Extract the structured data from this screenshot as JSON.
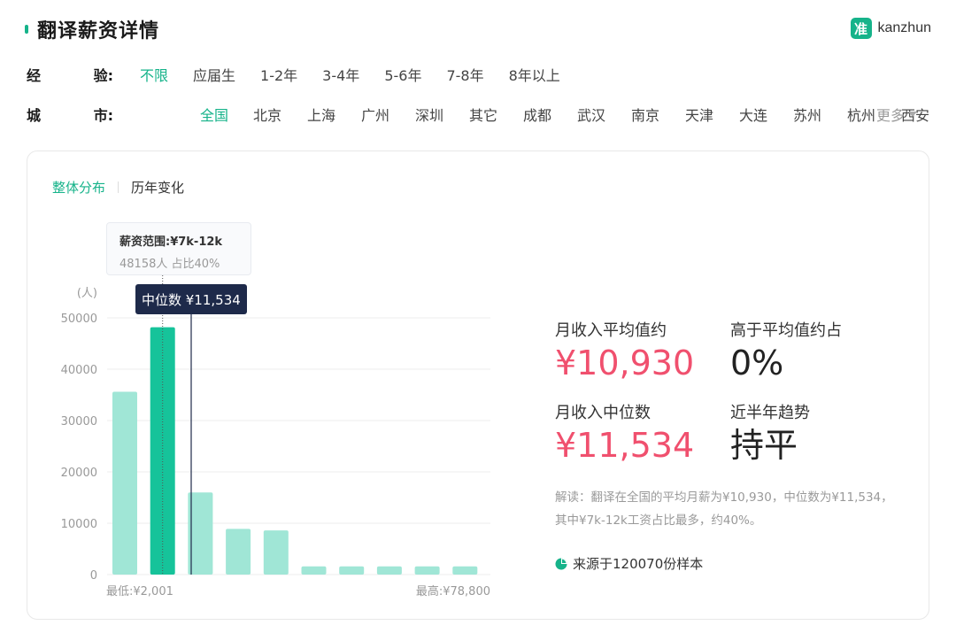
{
  "header": {
    "title": "翻译薪资详情",
    "brand_logo": "准",
    "brand_name": "kanzhun",
    "accent_color": "#16b38a"
  },
  "filters": {
    "experience": {
      "label_a": "经",
      "label_b": "验:",
      "options": [
        "不限",
        "应届生",
        "1-2年",
        "3-4年",
        "5-6年",
        "7-8年",
        "8年以上"
      ],
      "selected": "不限"
    },
    "city": {
      "label_a": "城",
      "label_b": "市:",
      "options": [
        "全国",
        "北京",
        "上海",
        "广州",
        "深圳",
        "其它",
        "成都",
        "武汉",
        "南京",
        "天津",
        "大连",
        "苏州",
        "杭州",
        "西安"
      ],
      "selected": "全国",
      "more_label": "更多"
    }
  },
  "tabs": [
    "整体分布",
    "历年变化"
  ],
  "active_tab": "整体分布",
  "tooltip": {
    "title": "薪资范围:¥7k-12k",
    "sub": "48158人  占比40%"
  },
  "median_marker": "中位数 ¥11,534",
  "chart_data": {
    "type": "bar",
    "ylabel": "(人)",
    "ylim": [
      0,
      50000
    ],
    "yticks": [
      "0",
      "10000",
      "20000",
      "30000",
      "40000",
      "50000"
    ],
    "xmin_label": "最低:¥2,001",
    "xmax_label": "最高:¥78,800",
    "values": [
      35600,
      48158,
      16000,
      8900,
      8600,
      1600,
      1600,
      1600,
      1600,
      1600
    ],
    "highlight_index": 1,
    "bar_color": "#a0e6d6",
    "highlight_color": "#16c39a"
  },
  "stats": {
    "avg_label": "月收入平均值约",
    "avg_value": "¥10,930",
    "above_label": "高于平均值约占",
    "above_value": "0%",
    "median_label": "月收入中位数",
    "median_value": "¥11,534",
    "trend_label": "近半年趋势",
    "trend_value": "持平",
    "value_color": "#f0506e"
  },
  "note": "解读：翻译在全国的平均月薪为¥10,930，中位数为¥11,534，其中¥7k-12k工资占比最多，约40%。",
  "source": "来源于120070份样本"
}
